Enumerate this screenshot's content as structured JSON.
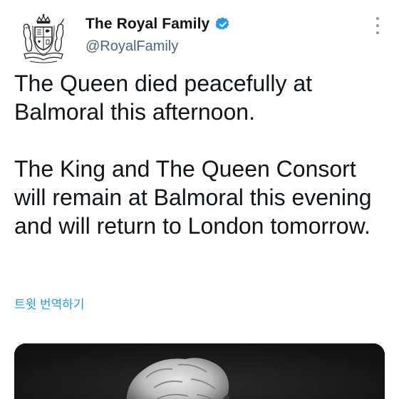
{
  "tweet": {
    "author": {
      "display_name": "The Royal Family",
      "handle": "@RoyalFamily",
      "verified": true,
      "avatar_icon": "royal-coat-of-arms-icon"
    },
    "paragraphs": [
      "The Queen died peacefully at Balmoral this afternoon.",
      "The King and The Queen Consort will remain at Balmoral this evening and will return to London tomorrow."
    ],
    "translate_label": "트윗 번역하기",
    "more_icon": "more-options-icon"
  },
  "colors": {
    "accent": "#1d9bf0",
    "text_primary": "#0f1419",
    "text_secondary": "#536471",
    "media_bg": "#161616"
  }
}
